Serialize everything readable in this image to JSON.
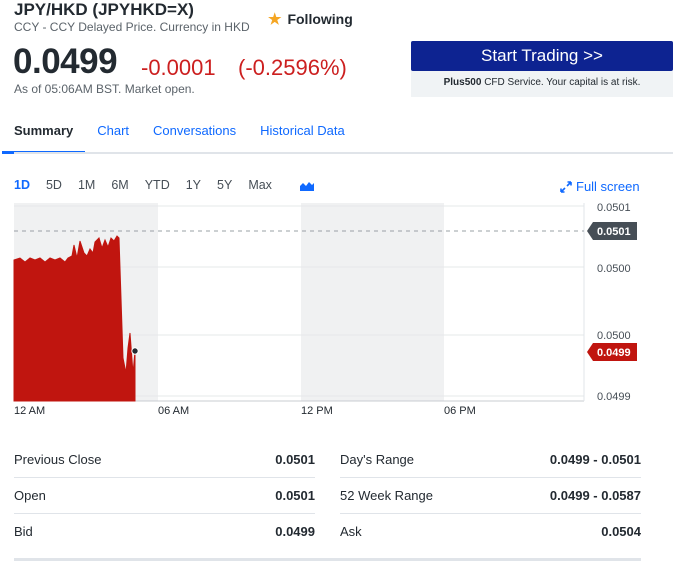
{
  "header": {
    "title": "JPY/HKD (JPYHKD=X)",
    "subtitle": "CCY - CCY Delayed Price. Currency in HKD",
    "follow_label": "Following"
  },
  "quote": {
    "price": "0.0499",
    "change": "-0.0001",
    "change_pct": "(-0.2596%)",
    "as_of": "As of 05:06AM BST. Market open."
  },
  "ad": {
    "button_label": "Start Trading >>",
    "brand": "Plus500",
    "note": " CFD Service. Your capital is at risk."
  },
  "tabs": [
    {
      "label": "Summary",
      "active": true
    },
    {
      "label": "Chart"
    },
    {
      "label": "Conversations"
    },
    {
      "label": "Historical Data"
    }
  ],
  "ranges": [
    "1D",
    "5D",
    "1M",
    "6M",
    "YTD",
    "1Y",
    "5Y",
    "Max"
  ],
  "active_range": "1D",
  "fullscreen_label": "Full screen",
  "chart_data": {
    "type": "area",
    "x_tick_labels": [
      "12 AM",
      "06 AM",
      "12 PM",
      "06 PM"
    ],
    "y_tick_labels": [
      "0.0501",
      "0.0500",
      "0.0500",
      "0.0499"
    ],
    "prev_close_label": "0.0501",
    "current_label": "0.0499",
    "series_color": "#c0150f",
    "prev_close_color": "#464e56"
  },
  "stats": {
    "left": [
      {
        "label": "Previous Close",
        "value": "0.0501"
      },
      {
        "label": "Open",
        "value": "0.0501"
      },
      {
        "label": "Bid",
        "value": "0.0499"
      }
    ],
    "right": [
      {
        "label": "Day's Range",
        "value": "0.0499 - 0.0501"
      },
      {
        "label": "52 Week Range",
        "value": "0.0499 - 0.0587"
      },
      {
        "label": "Ask",
        "value": "0.0504"
      }
    ]
  },
  "colors": {
    "accent": "#0f69ff",
    "negative": "#cc1f1f",
    "ad_button": "#0d2391"
  }
}
